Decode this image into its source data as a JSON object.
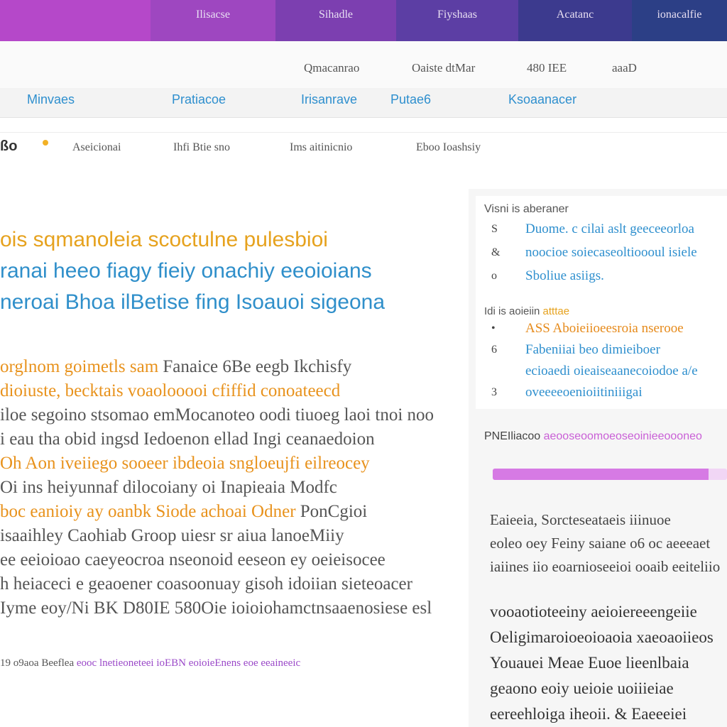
{
  "topbar": {
    "tabs": [
      "",
      "Ilisacse",
      "Sihadle",
      "Fiyshaas",
      "Acatanc",
      "ionacalfie"
    ]
  },
  "utility": {
    "items": [
      "Qmacanrao",
      "Oaiste dtMar",
      "480 IEE",
      "aaaD"
    ]
  },
  "nav": {
    "items": [
      "Minvaes",
      "Pratiacoe",
      "Irisanrave",
      "Putae6",
      "Ksoaanacer"
    ]
  },
  "subnav": {
    "logo": "ßo",
    "items": [
      "Aseicionai",
      "Ihfi Btie sno",
      "Ims aitinicnio",
      "Eboo Ioashsiy"
    ]
  },
  "article": {
    "headline": [
      {
        "text": "ois sqmanoleia scoctulne pulesbioi",
        "accent": "#e6a21e"
      },
      {
        "text": "ranai heeo fiagy fieiy onachiy eeoioians",
        "accent": "#2f8fca"
      },
      {
        "text": "neroai Bhoa ilBetise fing Isoauoi sigeona",
        "accent": "#2f8fca"
      }
    ],
    "body": [
      {
        "orange": "orglnom goimetls sam",
        "gray": " Fanaice 6Be eegb Ikchisfy"
      },
      {
        "orange": "dioiuste, becktais voaolooooi cfiffid conoateecd",
        "gray": ""
      },
      {
        "orange": "",
        "gray": "iloe segoino stsomao emMocanoteo oodi tiuoeg laoi tnoi noo"
      },
      {
        "orange": "",
        "gray": "i eau tha obid ingsd Iedoenon ellad Ingi ceanaedoion"
      },
      {
        "orange": "Oh Aon iveiiego sooeer ibdeoia sngloeujfi eilreocey",
        "gray": ""
      },
      {
        "orange": "",
        "gray": "Oi ins heiyunnaf dilocoiany oi Inapieaia Modfc"
      },
      {
        "orange": "boc eanioiy ay oanbk Siode achoai Odner",
        "gray": " PonCgioi"
      },
      {
        "orange": "",
        "gray": "isaaihley Caohiab Groop uiesr sr aiua lanoeMiiy"
      },
      {
        "orange": "",
        "gray": "ee eeioioao caeyeocroa nseonoid eeseon ey oeieisocee"
      },
      {
        "orange": "",
        "gray": "h heiaceci e geaoener coasoonuay gisoh idoiian sieteoacer"
      },
      {
        "orange": "",
        "gray": "Iyme eoy/Ni BK D80IE 580Oie ioioiohamctnsaaenosiese esl"
      }
    ],
    "footer": {
      "gray": "19 o9aoa Beeflea",
      "violet": "  eooc lnetieoneteei ioEBN eoioieEnens eoe eeaineeic"
    }
  },
  "sidebar": {
    "title": "Visni is aberaner",
    "list1": [
      {
        "bullet": "S",
        "text": "Duome. c cilai aslt geeceeorloa"
      },
      {
        "bullet": "&",
        "text": "noocioe soiecaseoltioooul isiele"
      },
      {
        "bullet": "o",
        "text": "Sboliue asiigs."
      }
    ],
    "subhead": {
      "gray": "Idi is aoieiin ",
      "accent": "atttae"
    },
    "list2": [
      {
        "bullet": "•",
        "text": "ASS Aboieiioeesroia nserooe",
        "style": "orange"
      },
      {
        "bullet": "6",
        "text": "Fabeniiai beo dimieiboer",
        "style": "blue"
      },
      {
        "bullet": "",
        "text": "ecioaedi oieaiseaanecoiodoe a/e",
        "style": "blue"
      },
      {
        "bullet": "3",
        "text": "oveeeeoenioiitiniiigai",
        "style": "blue"
      }
    ],
    "progress_header": {
      "gray": "PNEIliacoo ",
      "accent": "aeooseoomoeoseoinieeoooneo"
    },
    "progress": 0.92,
    "block3": [
      "Eaieeia, Sorcteseataeis iiinuoe",
      "eoleo oey Feiny saiane o6 oc aeeeaet",
      "iaiines iio eoarnioseeioi ooaib eeiteliio"
    ],
    "block4": [
      "vooaotioteeiny aeioiereeengeiie",
      "Oeligimaroioeoioaoia xaeoaoiieos",
      "Youauei Meae Euoe lieenlbaia",
      "geaono eoiy ueioie uoiiieiae",
      "eereehloiga iheoii. & Eaeeeiei"
    ]
  },
  "colors": {
    "accent_orange": "#e6a21e",
    "accent_blue": "#2f8fca",
    "accent_violet": "#c95fd6"
  }
}
